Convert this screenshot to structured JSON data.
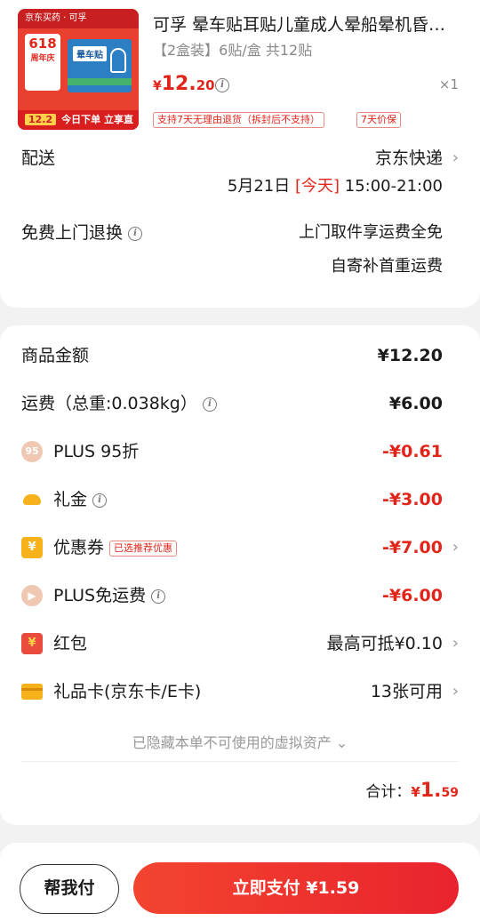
{
  "product": {
    "thumb_top": "京东买药 · 可孚",
    "thumb_618": "618",
    "thumb_618_sub": "周年庆",
    "thumb_box_label": "晕车贴",
    "thumb_bottom_price": "12.2",
    "thumb_bottom_text": "今日下单 立享直降",
    "title": "可孚 晕车贴耳贴儿童成人晕船晕机昏…",
    "spec": "【2盒装】6贴/盒 共12贴",
    "price_symbol": "¥",
    "price_int": "12.",
    "price_dec": "20",
    "quantity": "×1",
    "tags": [
      "支持7天无理由退货（拆封后不支持）",
      "7天价保"
    ]
  },
  "delivery": {
    "label": "配送",
    "method": "京东快递",
    "date": "5月21日",
    "today": "[今天]",
    "time": "15:00-21:00"
  },
  "returns": {
    "label": "免费上门退换",
    "line1": "上门取件享运费全免",
    "line2": "自寄补首重运费"
  },
  "costs": {
    "goods_label": "商品金额",
    "goods_value": "¥12.20",
    "shipping_label": "运费（总重:0.038kg）",
    "shipping_value": "¥6.00",
    "plus_label": "PLUS 95折",
    "plus_value": "-¥0.61",
    "plus_icon": "95",
    "gift_label": "礼金",
    "gift_value": "-¥3.00",
    "coupon_label": "优惠券",
    "coupon_badge": "已选推荐优惠",
    "coupon_value": "-¥7.00",
    "freeship_label": "PLUS免运费",
    "freeship_value": "-¥6.00",
    "redpacket_label": "红包",
    "redpacket_value": "最高可抵¥0.10",
    "giftcard_label": "礼品卡(京东卡/E卡)",
    "giftcard_value": "13张可用",
    "hidden_assets": "已隐藏本单不可使用的虚拟资产",
    "total_label": "合计：",
    "total_symbol": "¥",
    "total_int": "1.",
    "total_dec": "59"
  },
  "footer": {
    "help_pay": "帮我付",
    "pay_now": "立即支付 ¥1.59"
  },
  "colors": {
    "accent": "#e1251b",
    "coupon_gold": "#f7b21b"
  }
}
